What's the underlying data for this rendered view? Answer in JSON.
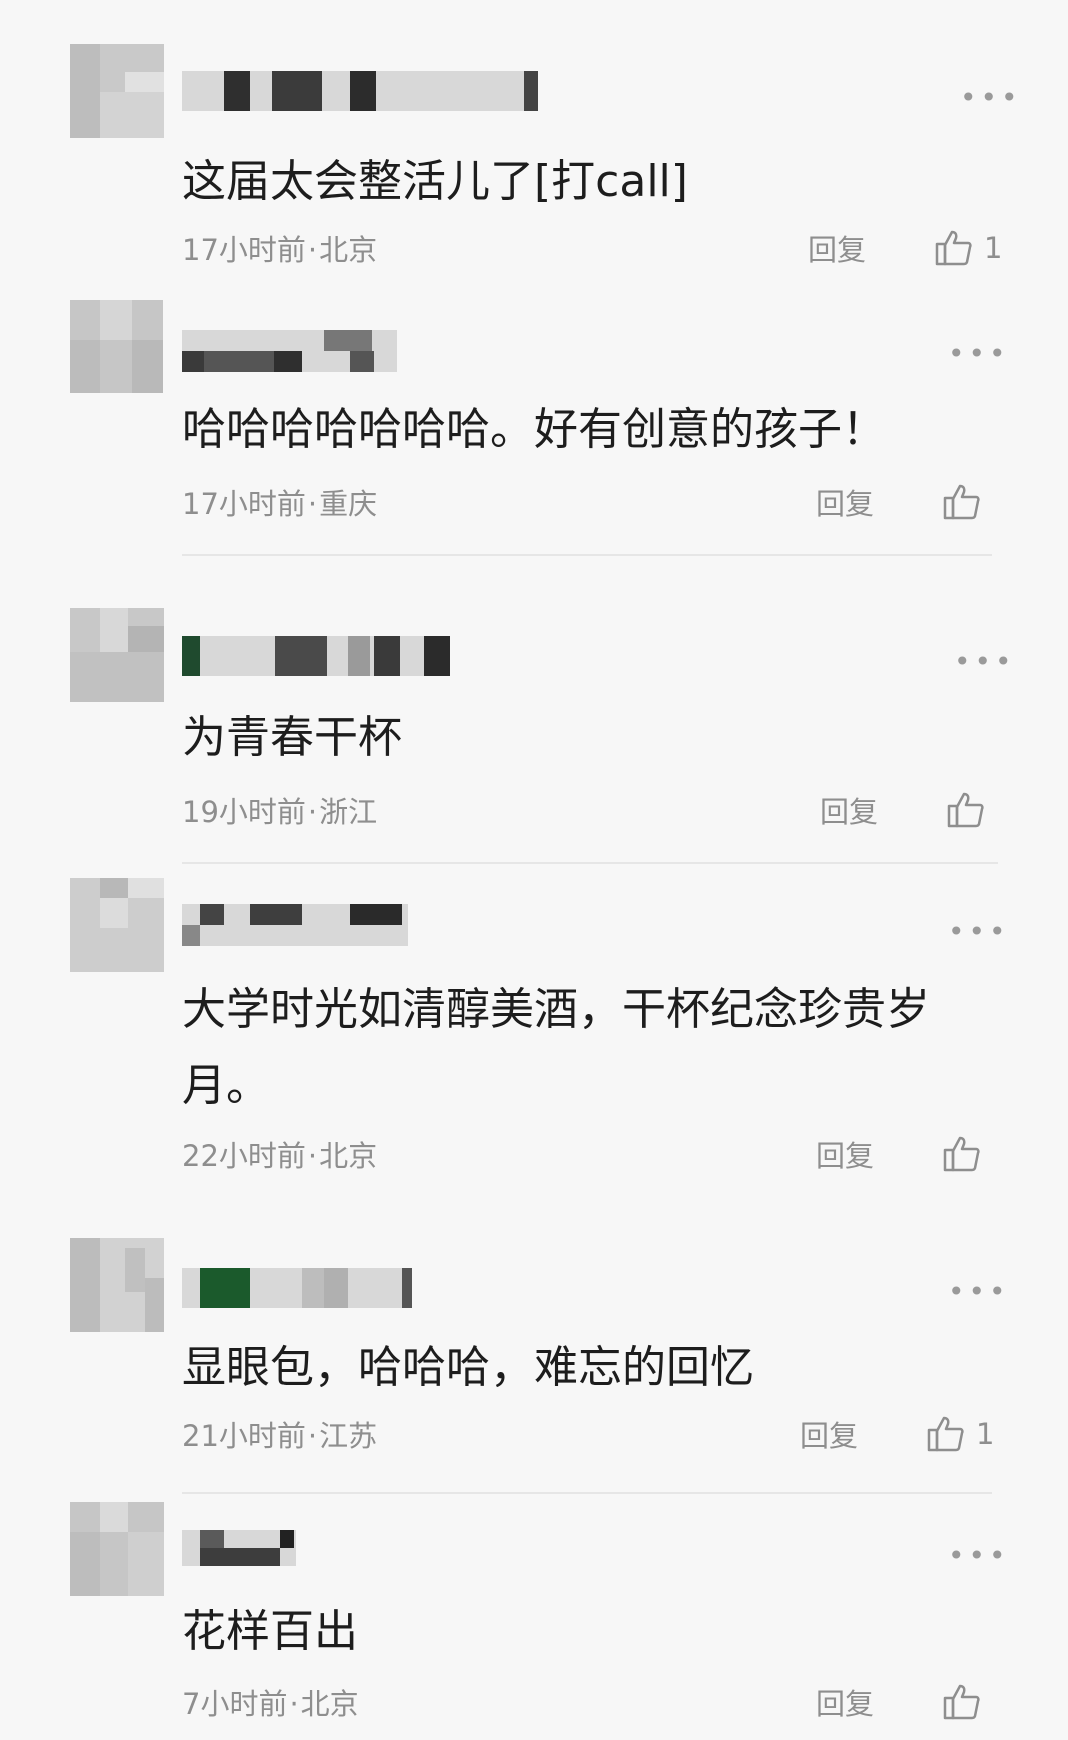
{
  "comments": [
    {
      "text": "这届太会整活儿了[打call]",
      "time": "17小时前",
      "location": "北京",
      "reply_label": "回复",
      "likes": "1",
      "like_icon": "thumbs-up-icon",
      "more_icon": "more-dots-icon"
    },
    {
      "text": "哈哈哈哈哈哈哈。好有创意的孩子！",
      "time": "17小时前",
      "location": "重庆",
      "reply_label": "回复",
      "likes": "",
      "like_icon": "thumbs-up-icon",
      "more_icon": "more-dots-icon"
    },
    {
      "text": "为青春干杯",
      "time": "19小时前",
      "location": "浙江",
      "reply_label": "回复",
      "likes": "",
      "like_icon": "thumbs-up-icon",
      "more_icon": "more-dots-icon"
    },
    {
      "text": "大学时光如清醇美酒，干杯纪念珍贵岁月。",
      "time": "22小时前",
      "location": "北京",
      "reply_label": "回复",
      "likes": "",
      "like_icon": "thumbs-up-icon",
      "more_icon": "more-dots-icon"
    },
    {
      "text": "显眼包，哈哈哈，难忘的回忆",
      "time": "21小时前",
      "location": "江苏",
      "reply_label": "回复",
      "likes": "1",
      "like_icon": "thumbs-up-icon",
      "more_icon": "more-dots-icon"
    },
    {
      "text": "花样百出",
      "time": "7小时前",
      "location": "北京",
      "reply_label": "回复",
      "likes": "",
      "like_icon": "thumbs-up-icon",
      "more_icon": "more-dots-icon"
    }
  ],
  "meta_separator": "·",
  "more_glyph": "•••",
  "colors": {
    "background": "#f7f7f7",
    "text": "#1d1d1d",
    "meta": "#8e8e8e",
    "divider": "#e6e6e6"
  }
}
